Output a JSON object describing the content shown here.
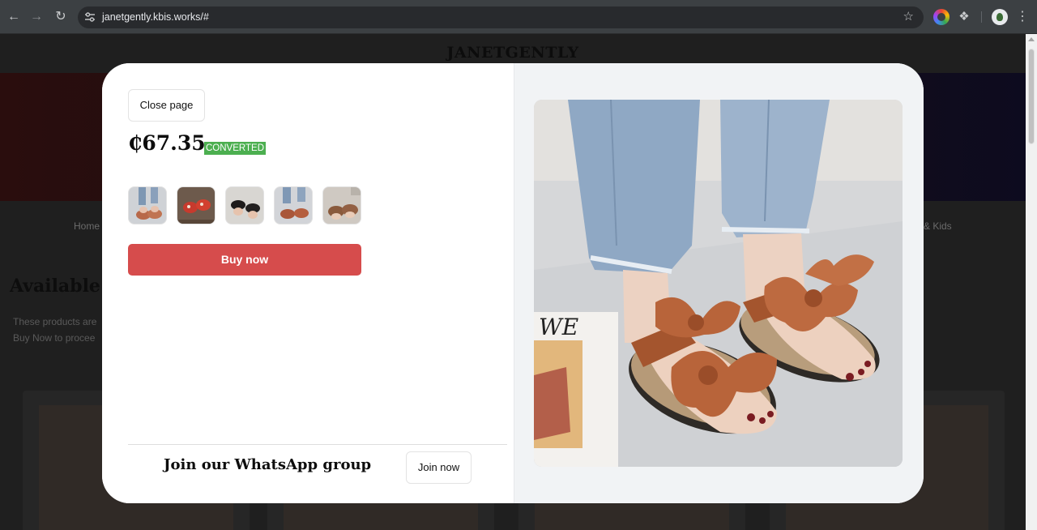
{
  "browser": {
    "url": "janetgently.kbis.works/#",
    "icons": [
      "back-icon",
      "forward-icon",
      "reload-icon",
      "site-settings-icon",
      "bookmark-star-icon",
      "color-extension-icon",
      "extensions-puzzle-icon",
      "profile-avatar",
      "menu-kebab-icon"
    ]
  },
  "site": {
    "brand": "JANETGENTLY",
    "menu_home": "Home",
    "menu_kids": "& Kids",
    "heading_partial": "Available",
    "text_line1_partial": "These products are",
    "text_line2_partial": "Buy Now to procee"
  },
  "modal": {
    "close_label": "Close page",
    "price": "₵67.35",
    "badge": "CONVERTED",
    "buy_label": "Buy now",
    "whatsapp_text": "Join our WhatsApp group",
    "join_label": "Join now",
    "thumbnails": [
      {
        "name": "thumb-sandal-brown-1"
      },
      {
        "name": "thumb-sandal-red"
      },
      {
        "name": "thumb-sandal-black"
      },
      {
        "name": "thumb-sandal-brown-2"
      },
      {
        "name": "thumb-sandal-brown-3"
      }
    ],
    "main_image_name": "product-image-bow-sandals"
  },
  "colors": {
    "buy_button": "#d64c4c",
    "badge": "#4caf50"
  }
}
